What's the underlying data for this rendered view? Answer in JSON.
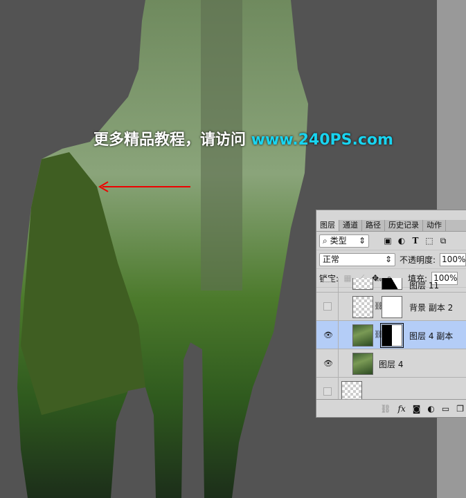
{
  "banner": {
    "text": "更多精品教程，请访问 ",
    "url": "www.240PS.com"
  },
  "panel": {
    "tabs": [
      "图层",
      "通道",
      "路径",
      "历史记录",
      "动作"
    ],
    "filter": {
      "icon": "search-icon",
      "value": "类型"
    },
    "filter_icons": [
      "image-filter-icon",
      "adjustment-filter-icon",
      "type-filter-icon",
      "shape-filter-icon",
      "smart-object-filter-icon"
    ],
    "blend_mode": "正常",
    "opacity_label": "不透明度:",
    "opacity": "100%",
    "lock_label": "锁定:",
    "fill_label": "填充:",
    "fill": "100%",
    "layers": [
      {
        "name": "图层 11",
        "visible": false
      },
      {
        "name": "背景 副本 2",
        "visible": false
      },
      {
        "name": "图层 4 副本",
        "visible": true,
        "selected": true
      },
      {
        "name": "图层 4",
        "visible": true
      },
      {
        "name": "",
        "visible": false
      }
    ],
    "footer_icons": [
      "link-icon",
      "fx-icon",
      "mask-icon",
      "adjustment-icon",
      "folder-icon",
      "new-layer-icon"
    ]
  },
  "colors": {
    "canvas": "#535353",
    "url": "#19d4f0",
    "selected_layer": "#b4cdf7"
  }
}
